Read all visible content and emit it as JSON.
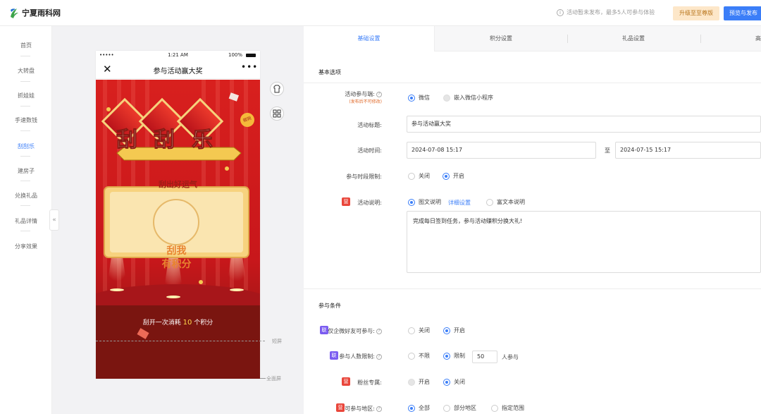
{
  "brand": {
    "name": "宁夏雨科网"
  },
  "header": {
    "notice": "活动暂未发布，最多5人可参与体验",
    "upgrade_label": "升级至至尊版",
    "publish_label": "预览与发布"
  },
  "sidebar": {
    "items": [
      {
        "label": "首页"
      },
      {
        "label": "大转盘"
      },
      {
        "label": "抓娃娃"
      },
      {
        "label": "手速数钱"
      },
      {
        "label": "刮刮乐"
      },
      {
        "label": "建房子"
      },
      {
        "label": "兑换礼品"
      },
      {
        "label": "礼品详情"
      },
      {
        "label": "分享效果"
      }
    ],
    "active_index": 4,
    "collapse_glyph": "«"
  },
  "phone": {
    "status_dots": "•••••",
    "status_time": "1:21 AM",
    "status_battery": "100%",
    "title": "参与活动赢大奖",
    "close_glyph": "✕",
    "more_glyph": "•••",
    "game_title_chars": [
      "刮",
      "刮",
      "乐"
    ],
    "game_subtitle": "刮出好运气",
    "card_text_line1": "刮我",
    "card_text_line2": "有积分",
    "cost_prefix": "刮开一次消耗",
    "cost_value": "10",
    "cost_suffix": "个积分",
    "corner_badge": "规则",
    "short_screen_label": "短屏",
    "full_screen_label": "全面屏"
  },
  "tabs": [
    {
      "label": "基础设置"
    },
    {
      "label": "积分设置"
    },
    {
      "label": "礼品设置"
    },
    {
      "label": "高"
    }
  ],
  "basic": {
    "section_title": "基本选项",
    "participation": {
      "label": "活动参与端:",
      "sub": "(发布后不可修改)",
      "options": [
        "微信",
        "嵌入微信小程序"
      ]
    },
    "activity_title": {
      "label": "活动标题:",
      "value": "参与活动赢大奖"
    },
    "activity_time": {
      "label": "活动时间:",
      "start": "2024-07-08 15:17",
      "to": "至",
      "end": "2024-07-15 15:17"
    },
    "time_limit": {
      "label": "参与时段限制:",
      "options": [
        "关闭",
        "开启"
      ]
    },
    "description": {
      "badge": "营",
      "label": "活动说明:",
      "options": [
        "图文说明",
        "富文本说明"
      ],
      "detail_link": "详细设置",
      "text": "完成每日签到任务，参与活动赚积分换大礼!"
    }
  },
  "conditions": {
    "section_title": "参与条件",
    "friends_only": {
      "badge": "联",
      "label": "仅企微好友可参与:",
      "options": [
        "关闭",
        "开启"
      ]
    },
    "count_limit": {
      "badge": "联",
      "label": "参与人数限制:",
      "options": [
        "不限",
        "限制"
      ],
      "value": "50",
      "unit": "人参与"
    },
    "fans_only": {
      "badge": "营",
      "label": "粉丝专属:",
      "options": [
        "开启",
        "关闭"
      ]
    },
    "region": {
      "badge": "营",
      "label": "可参与地区:",
      "options": [
        "全部",
        "部分地区",
        "指定范围"
      ]
    }
  },
  "colors": {
    "accent": "#3b7ef8",
    "red": "#c4161c",
    "gold": "#f8d27a"
  }
}
